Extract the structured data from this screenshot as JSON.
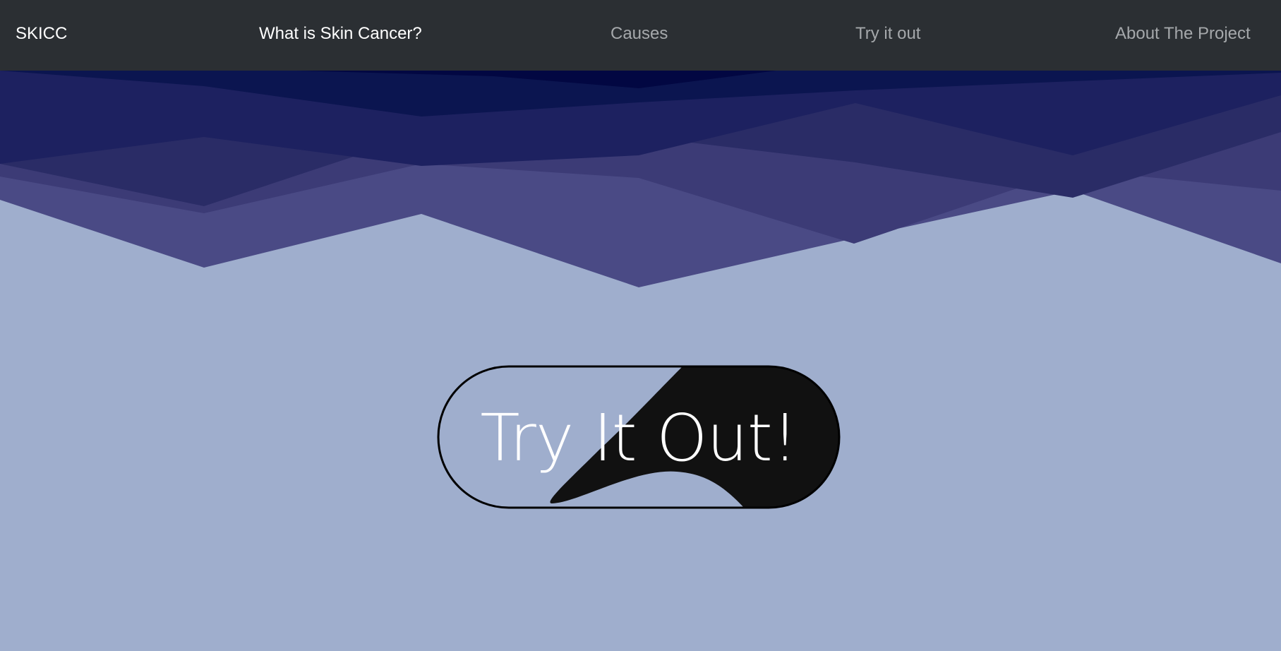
{
  "nav": {
    "brand": "SKICC",
    "items": [
      {
        "label": "What is Skin Cancer?",
        "active": true
      },
      {
        "label": "Causes",
        "active": false
      },
      {
        "label": "Try it out",
        "active": false
      },
      {
        "label": "About The Project",
        "active": false
      }
    ]
  },
  "hero": {
    "cta_label": "Try It Out!"
  },
  "colors": {
    "navbar": "#2b2f33",
    "background": "#9faecd",
    "wave_dark": "#020742",
    "wave_mid": "#1d2160",
    "wave_light": "#4a4a85",
    "button_fill": "#111111"
  }
}
